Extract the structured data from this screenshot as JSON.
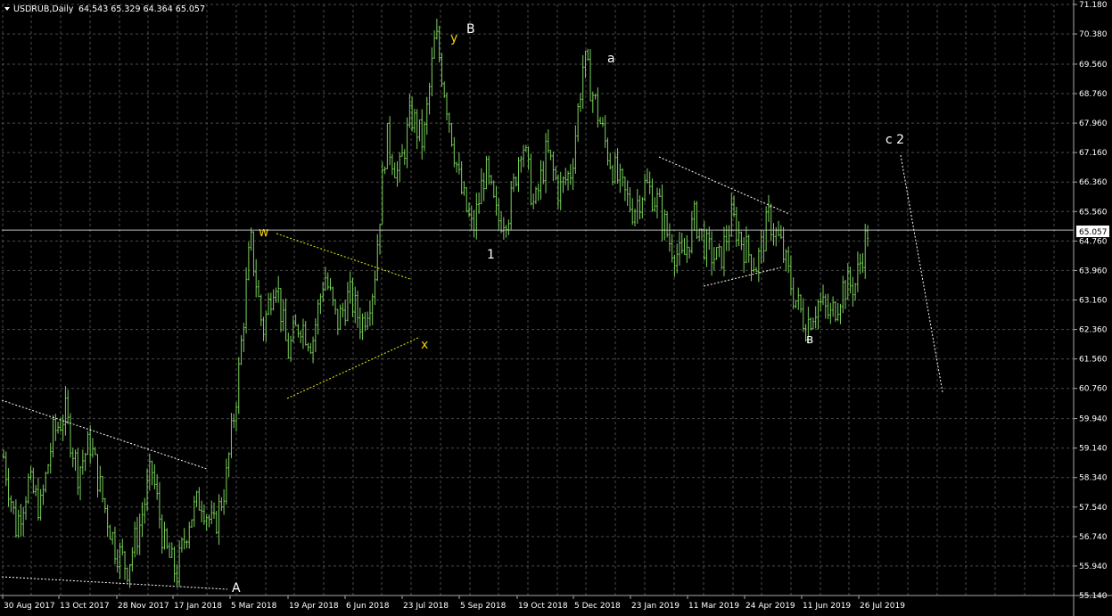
{
  "header": {
    "symbol_timeframe": "USDRUB,Daily",
    "ohlc": "64.543 65.329 64.364 65.057"
  },
  "current_price": "65.057",
  "colors": {
    "background": "#000000",
    "grid": "#4a4a4a",
    "candles": "#7ad05a",
    "axis_text": "#ffffff",
    "wave_labels_white": "#ffffff",
    "wave_labels_yellow": "#f0d000",
    "trendlines_white": "#ffffff",
    "trendlines_yellow": "#f0f000",
    "price_badge_bg": "#ffffff",
    "price_badge_text": "#000000"
  },
  "chart_data": {
    "type": "bar",
    "title": "USDRUB,Daily",
    "yticks": [
      "71.180",
      "70.380",
      "69.560",
      "68.760",
      "67.960",
      "67.160",
      "66.360",
      "65.560",
      "64.760",
      "63.960",
      "63.160",
      "62.360",
      "61.560",
      "60.760",
      "59.940",
      "59.140",
      "58.340",
      "57.540",
      "56.740",
      "55.940",
      "55.140"
    ],
    "ylim": [
      55.14,
      71.18
    ],
    "xticks": [
      "30 Aug 2017",
      "13 Oct 2017",
      "28 Nov 2017",
      "17 Jan 2018",
      "5 Mar 2018",
      "19 Apr 2018",
      "6 Jun 2018",
      "23 Jul 2018",
      "5 Sep 2018",
      "19 Oct 2018",
      "5 Dec 2018",
      "23 Jan 2019",
      "11 Mar 2019",
      "24 Apr 2019",
      "11 Jun 2019",
      "26 Jul 2019"
    ],
    "grid": true,
    "series_anchors": [
      {
        "date": "30 Aug 2017",
        "close": 58.9
      },
      {
        "date": "Sep 2017",
        "close": 57.0
      },
      {
        "date": "Oct 2017",
        "close": 58.2
      },
      {
        "date": "13 Oct 2017",
        "close": 57.5
      },
      {
        "date": "Nov 2017",
        "close": 59.5
      },
      {
        "date": "15 Nov 2017",
        "close": 60.1
      },
      {
        "date": "28 Nov 2017",
        "close": 58.5
      },
      {
        "date": "Dec 2017",
        "close": 59.3
      },
      {
        "date": "Dec 2017",
        "close": 57.8
      },
      {
        "date": "Jan 2018",
        "close": 56.5
      },
      {
        "date": "17 Jan 2018",
        "close": 55.9
      },
      {
        "date": "Jan 2018",
        "close": 57.0
      },
      {
        "date": "Feb 2018",
        "close": 58.6
      },
      {
        "date": "Feb 2018",
        "close": 56.5
      },
      {
        "date": "Feb 2018",
        "close": 55.7
      },
      {
        "date": "5 Mar 2018",
        "close": 57.2
      },
      {
        "date": "Mar 2018",
        "close": 57.8
      },
      {
        "date": "Mar 2018",
        "close": 56.9
      },
      {
        "date": "Mar 2018",
        "close": 58.2
      },
      {
        "date": "Apr 2018",
        "close": 61.0
      },
      {
        "date": "Apr 2018",
        "close": 64.8
      },
      {
        "date": "19 Apr 2018",
        "close": 62.3
      },
      {
        "date": "May 2018",
        "close": 63.9
      },
      {
        "date": "May 2018",
        "close": 61.7
      },
      {
        "date": "May 2018",
        "close": 62.6
      },
      {
        "date": "6 Jun 2018",
        "close": 62.0
      },
      {
        "date": "Jun 2018",
        "close": 63.9
      },
      {
        "date": "Jun 2018",
        "close": 62.5
      },
      {
        "date": "Jul 2018",
        "close": 63.3
      },
      {
        "date": "Jul 2018",
        "close": 62.5
      },
      {
        "date": "23 Jul 2018",
        "close": 63.6
      },
      {
        "date": "Aug 2018",
        "close": 67.6
      },
      {
        "date": "Aug 2018",
        "close": 66.5
      },
      {
        "date": "Aug 2018",
        "close": 68.2
      },
      {
        "date": "Aug 2018",
        "close": 67.4
      },
      {
        "date": "Sep 2018",
        "close": 70.4
      },
      {
        "date": "5 Sep 2018",
        "close": 68.3
      },
      {
        "date": "Sep 2018",
        "close": 66.2
      },
      {
        "date": "Sep 2018",
        "close": 65.0
      },
      {
        "date": "Oct 2018",
        "close": 66.7
      },
      {
        "date": "Oct 2018",
        "close": 65.3
      },
      {
        "date": "19 Oct 2018",
        "close": 65.6
      },
      {
        "date": "Nov 2018",
        "close": 67.6
      },
      {
        "date": "Nov 2018",
        "close": 65.6
      },
      {
        "date": "Nov 2018",
        "close": 67.2
      },
      {
        "date": "Nov 2018",
        "close": 66.1
      },
      {
        "date": "5 Dec 2018",
        "close": 66.7
      },
      {
        "date": "Dec 2018",
        "close": 69.7
      },
      {
        "date": "Dec 2018",
        "close": 68.4
      },
      {
        "date": "Jan 2019",
        "close": 67.1
      },
      {
        "date": "Jan 2019",
        "close": 66.2
      },
      {
        "date": "23 Jan 2019",
        "close": 65.6
      },
      {
        "date": "Feb 2019",
        "close": 66.3
      },
      {
        "date": "Feb 2019",
        "close": 65.8
      },
      {
        "date": "Feb 2019",
        "close": 64.7
      },
      {
        "date": "Mar 2019",
        "close": 64.2
      },
      {
        "date": "11 Mar 2019",
        "close": 65.4
      },
      {
        "date": "Mar 2019",
        "close": 64.5
      },
      {
        "date": "Apr 2019",
        "close": 64.2
      },
      {
        "date": "Apr 2019",
        "close": 65.4
      },
      {
        "date": "24 Apr 2019",
        "close": 64.6
      },
      {
        "date": "May 2019",
        "close": 64.1
      },
      {
        "date": "May 2019",
        "close": 65.4
      },
      {
        "date": "May 2019",
        "close": 64.6
      },
      {
        "date": "Jun 2019",
        "close": 63.3
      },
      {
        "date": "Jun 2019",
        "close": 62.5
      },
      {
        "date": "11 Jun 2019",
        "close": 63.1
      },
      {
        "date": "Jul 2019",
        "close": 62.7
      },
      {
        "date": "Jul 2019",
        "close": 63.5
      },
      {
        "date": "26 Jul 2019",
        "close": 63.6
      },
      {
        "date": "Aug 2019",
        "close": 65.06
      }
    ],
    "wave_labels": [
      {
        "text": "A",
        "color": "white",
        "date": "5 Mar 2018",
        "price": 55.4
      },
      {
        "text": "w",
        "color": "yellow",
        "date": "Apr 2018",
        "price": 65.0
      },
      {
        "text": "x",
        "color": "yellow",
        "date": "Jul 2018",
        "price": 62.0
      },
      {
        "text": "y",
        "color": "yellow",
        "date": "Aug 2018",
        "price": 70.4
      },
      {
        "text": "B",
        "color": "white",
        "date": "Sep 2018",
        "price": 70.6
      },
      {
        "text": "1",
        "color": "white",
        "date": "Sep 2018",
        "price": 64.3
      },
      {
        "text": "a",
        "color": "white",
        "date": "Dec 2018",
        "price": 69.8
      },
      {
        "text": "в",
        "color": "white",
        "date": "Jun 2019",
        "price": 62.2
      },
      {
        "text": "c 2",
        "color": "white",
        "date": "Aug 2019",
        "price": 67.5
      }
    ]
  }
}
